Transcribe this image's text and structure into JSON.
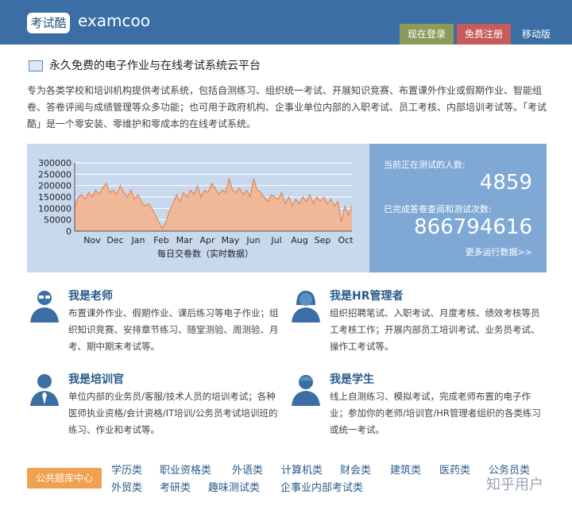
{
  "header": {
    "logo_text": "考试酷",
    "brand": "examcoo",
    "login_label": "现在登录",
    "register_label": "免费注册",
    "mobile_label": "移动版"
  },
  "slogan": "永久免费的电子作业与在线考试系统云平台",
  "intro": "专为各类学校和培训机构提供考试系统，包括自测练习、组织统一考试、开展知识竞赛、布置课外作业或假期作业、智能组卷、答卷评阅与成绩管理等众多功能；也可用于政府机构、企事业单位内部的入职考试、员工考核、内部培训考试等。「考试酷」是一个零安装、零维护和零成本的在线考试系统。",
  "stats": {
    "testing_label": "当前正在测试的人数:",
    "testing_value": "4859",
    "completed_label": "已完成答卷查阅和测试次数:",
    "completed_value": "866794616",
    "more_label": "更多运行数据>>"
  },
  "chart_data": {
    "type": "area",
    "title": "",
    "xlabel": "每日交卷数（实时数据）",
    "ylabel": "",
    "ylim": [
      0,
      300000
    ],
    "yticks": [
      "300000",
      "250000",
      "200000",
      "150000",
      "100000",
      "50000",
      "0"
    ],
    "months": [
      "Nov",
      "Dec",
      "Jan",
      "Feb",
      "Mar",
      "Apr",
      "May",
      "Jun",
      "Jul",
      "Aug",
      "Sep",
      "Oct"
    ],
    "series": [
      {
        "values": [
          100000,
          150000,
          160000,
          140000,
          170000,
          150000,
          180000,
          160000,
          190000,
          210000,
          170000,
          180000,
          160000,
          200000,
          170000,
          150000,
          180000,
          140000,
          160000,
          130000,
          110000,
          120000,
          100000,
          70000,
          40000,
          10000,
          40000,
          90000,
          120000,
          160000,
          130000,
          170000,
          150000,
          180000,
          160000,
          200000,
          150000,
          180000,
          170000,
          210000,
          190000,
          160000,
          180000,
          170000,
          230000,
          180000,
          170000,
          190000,
          160000,
          180000,
          150000,
          230000,
          180000,
          170000,
          150000,
          130000,
          160000,
          150000,
          140000,
          170000,
          120000,
          150000,
          110000,
          140000,
          120000,
          150000,
          130000,
          160000,
          120000,
          150000,
          130000,
          150000,
          120000,
          140000,
          110000,
          130000,
          40000,
          110000,
          70000,
          110000
        ]
      }
    ],
    "colors": {
      "fill": "#f0b898",
      "line": "#e0875a",
      "grid": "#ffffff"
    }
  },
  "roles": [
    {
      "icon": "teacher-icon",
      "title": "我是老师",
      "desc": "布置课外作业、假期作业、课后练习等电子作业；组织知识竞赛、安排章节练习、随堂测验、周测验、月考、期中期末考试等。"
    },
    {
      "icon": "hr-manager-icon",
      "title": "我是HR管理者",
      "desc": "组织招聘笔试、入职考试、月度考核、绩效考核等员工考核工作；开展内部员工培训考试、业务员考试、操作工考试等。"
    },
    {
      "icon": "trainer-icon",
      "title": "我是培训官",
      "desc": "单位内部的业务员/客服/技术人员的培训考试；各种医师执业资格/会计资格/IT培训/公务员考试培训班的练习、作业和考试等。"
    },
    {
      "icon": "student-icon",
      "title": "我是学生",
      "desc": "线上自测练习、模拟考试，完成老师布置的电子作业；参加你的老师/培训官/HR管理者组织的各类练习或统一考试。"
    }
  ],
  "bank": {
    "pill_label": "公共题库中心",
    "categories_row1": [
      "学历类",
      "职业资格类",
      "外语类",
      "计算机类",
      "财会类",
      "建筑类",
      "医药类",
      "公务员类"
    ],
    "categories_row2": [
      "外贸类",
      "考研类",
      "趣味测试类",
      "企事业内部考试类"
    ]
  },
  "watermark": "知乎用户"
}
